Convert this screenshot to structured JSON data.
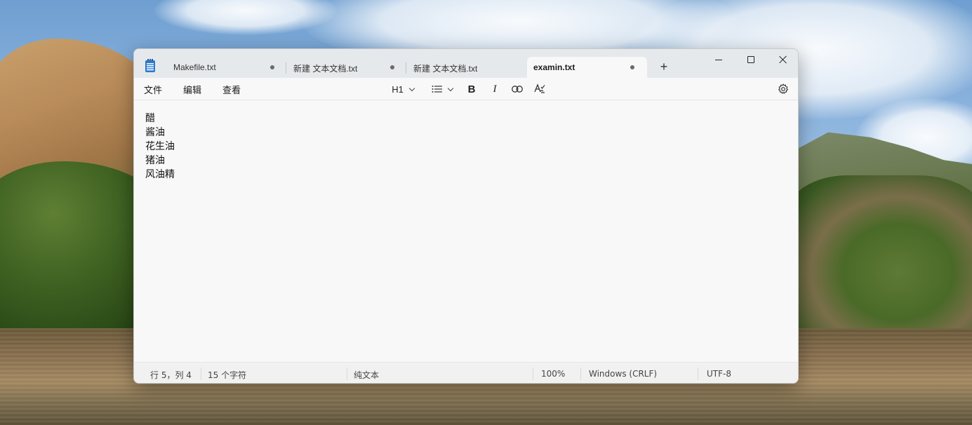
{
  "window": {
    "tabs": [
      {
        "label": "Makefile.txt",
        "active": false,
        "unsaved": true
      },
      {
        "label": "新建 文本文档.txt",
        "active": false,
        "unsaved": true
      },
      {
        "label": "新建 文本文档.txt",
        "active": false,
        "unsaved": false
      },
      {
        "label": "examin.txt",
        "active": true,
        "unsaved": true
      }
    ],
    "new_tab_icon": "plus-icon",
    "controls": [
      "minimize",
      "maximize",
      "close"
    ]
  },
  "menubar": {
    "menus": [
      "文件",
      "编辑",
      "查看"
    ],
    "heading_label": "H1",
    "toolbar_icons": [
      "heading-dropdown",
      "list-icon",
      "bold-icon",
      "italic-icon",
      "link-icon",
      "spellcheck-icon",
      "gear-icon"
    ],
    "bold_glyph": "B",
    "italic_glyph": "I"
  },
  "editor": {
    "lines": [
      "醋",
      "酱油",
      "花生油",
      "猪油",
      "风油精"
    ]
  },
  "status": {
    "position": "行 5，列 4",
    "char_count": "15 个字符",
    "format": "纯文本",
    "zoom": "100%",
    "line_ending": "Windows (CRLF)",
    "encoding": "UTF-8"
  }
}
